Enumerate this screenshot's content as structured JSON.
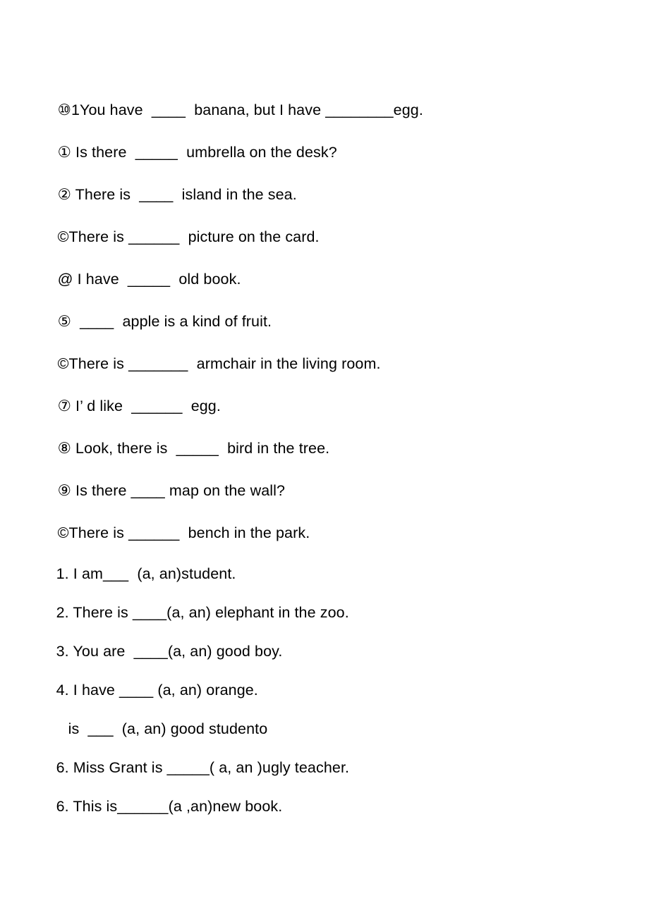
{
  "document": {
    "type": "worksheet",
    "background_color": "#ffffff",
    "text_color": "#000000",
    "sections": [
      {
        "name": "articles-fill-in-blanks-circled",
        "items": [
          {
            "marker": "⑩1",
            "text": "You have  ____  banana, but I have ________egg."
          },
          {
            "marker": "①",
            "text": " Is there  _____  umbrella on the desk?"
          },
          {
            "marker": "②",
            "text": " There is  ____  island in the sea."
          },
          {
            "marker": "©",
            "text": "There is ______  picture on the card."
          },
          {
            "marker": "@",
            "text": " I have  _____  old book."
          },
          {
            "marker": "⑤",
            "text": "  ____  apple is a kind of fruit."
          },
          {
            "marker": "©",
            "text": "There is _______  armchair in the living room."
          },
          {
            "marker": "⑦",
            "text": " I’ d like  ______  egg."
          },
          {
            "marker": "⑧",
            "text": " Look, there is  _____  bird in the tree."
          },
          {
            "marker": "⑨",
            "text": " Is there ____ map on the wall?"
          },
          {
            "marker": "©",
            "text": "There is ______  bench in the park."
          }
        ]
      },
      {
        "name": "articles-choose-a-or-an",
        "items": [
          {
            "marker": "1.",
            "text": " I am___  (a, an)student.",
            "indented": false
          },
          {
            "marker": "2.",
            "text": " There is ____(a, an) elephant in the zoo.",
            "indented": false
          },
          {
            "marker": "3.",
            "text": " You are  ____(a, an) good boy.",
            "indented": false
          },
          {
            "marker": "4.",
            "text": " I have ____ (a, an) orange.",
            "indented": false
          },
          {
            "marker": "",
            "text": "is  ___  (a, an) good studento",
            "indented": true
          },
          {
            "marker": "6.",
            "text": " Miss Grant is _____( a, an )ugly teacher.",
            "indented": false
          },
          {
            "marker": "6.",
            "text": " This is______(a ,an)new book.",
            "indented": false
          }
        ]
      }
    ]
  }
}
